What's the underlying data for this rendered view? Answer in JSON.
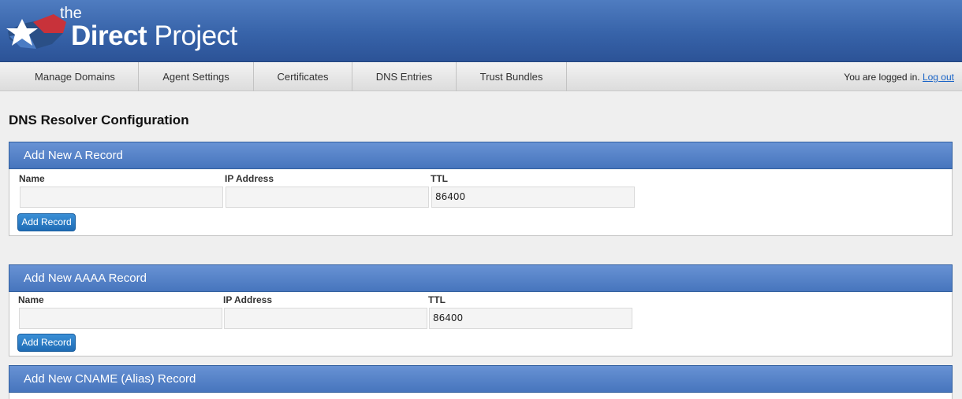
{
  "header": {
    "logo_the": "the",
    "logo_direct": "Direct",
    "logo_project": "Project"
  },
  "nav": {
    "items": [
      {
        "label": "Manage Domains"
      },
      {
        "label": "Agent Settings"
      },
      {
        "label": "Certificates"
      },
      {
        "label": "DNS Entries"
      },
      {
        "label": "Trust Bundles"
      }
    ],
    "status_text": "You are logged in.",
    "logout_label": "Log out"
  },
  "page": {
    "title": "DNS Resolver Configuration"
  },
  "a_record": {
    "heading": "Add New A Record",
    "name_label": "Name",
    "ip_label": "IP Address",
    "ttl_label": "TTL",
    "name_value": "",
    "ip_value": "",
    "ttl_value": "86400",
    "button_label": "Add Record"
  },
  "aaaa_record": {
    "heading": "Add New AAAA Record",
    "name_label": "Name",
    "ip_label": "IP Address",
    "ttl_label": "TTL",
    "name_value": "",
    "ip_value": "",
    "ttl_value": "86400",
    "button_label": "Add Record"
  },
  "cname_record": {
    "heading": "Add New CNAME (Alias) Record"
  },
  "colors": {
    "header_blue": "#3763a9",
    "panel_head_blue": "#4775bd",
    "button_blue": "#1f6cb5",
    "link_blue": "#1a64c7"
  }
}
